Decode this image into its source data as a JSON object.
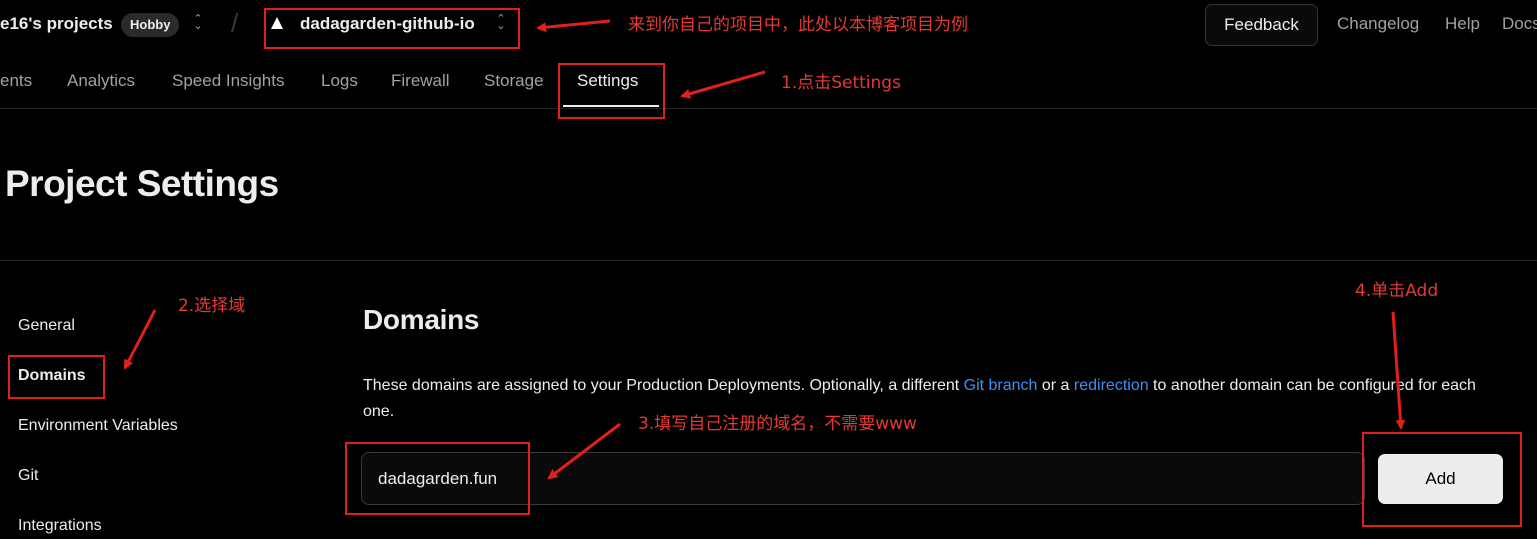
{
  "header": {
    "team_name": "e16's projects",
    "plan_badge": "Hobby",
    "project_name": "dadagarden-github-io",
    "feedback_label": "Feedback",
    "links": [
      "Changelog",
      "Help",
      "Docs"
    ]
  },
  "tabs": [
    "ents",
    "Analytics",
    "Speed Insights",
    "Logs",
    "Firewall",
    "Storage",
    "Settings"
  ],
  "active_tab": "Settings",
  "page_title": "Project Settings",
  "sidebar": {
    "items": [
      "General",
      "Domains",
      "Environment Variables",
      "Git",
      "Integrations"
    ],
    "active": "Domains"
  },
  "domains": {
    "title": "Domains",
    "desc_part1": "These domains are assigned to your Production Deployments. Optionally, a different ",
    "desc_link1": "Git branch",
    "desc_part2": " or a ",
    "desc_link2": "redirection",
    "desc_part3": " to another domain can be configured for each one.",
    "input_value": "dadagarden.fun",
    "add_label": "Add"
  },
  "annotations": {
    "project_note": "来到你自己的项目中，此处以本博客项目为例",
    "step1": "1.点击Settings",
    "step2": "2.选择域",
    "step3": "3.填写自己注册的域名，不需要www",
    "step4": "4.单击Add"
  },
  "colors": {
    "background": "#000000",
    "text": "#ededed",
    "muted": "#a1a1a1",
    "link": "#3d8ff0",
    "annotation": "#e0201b"
  }
}
